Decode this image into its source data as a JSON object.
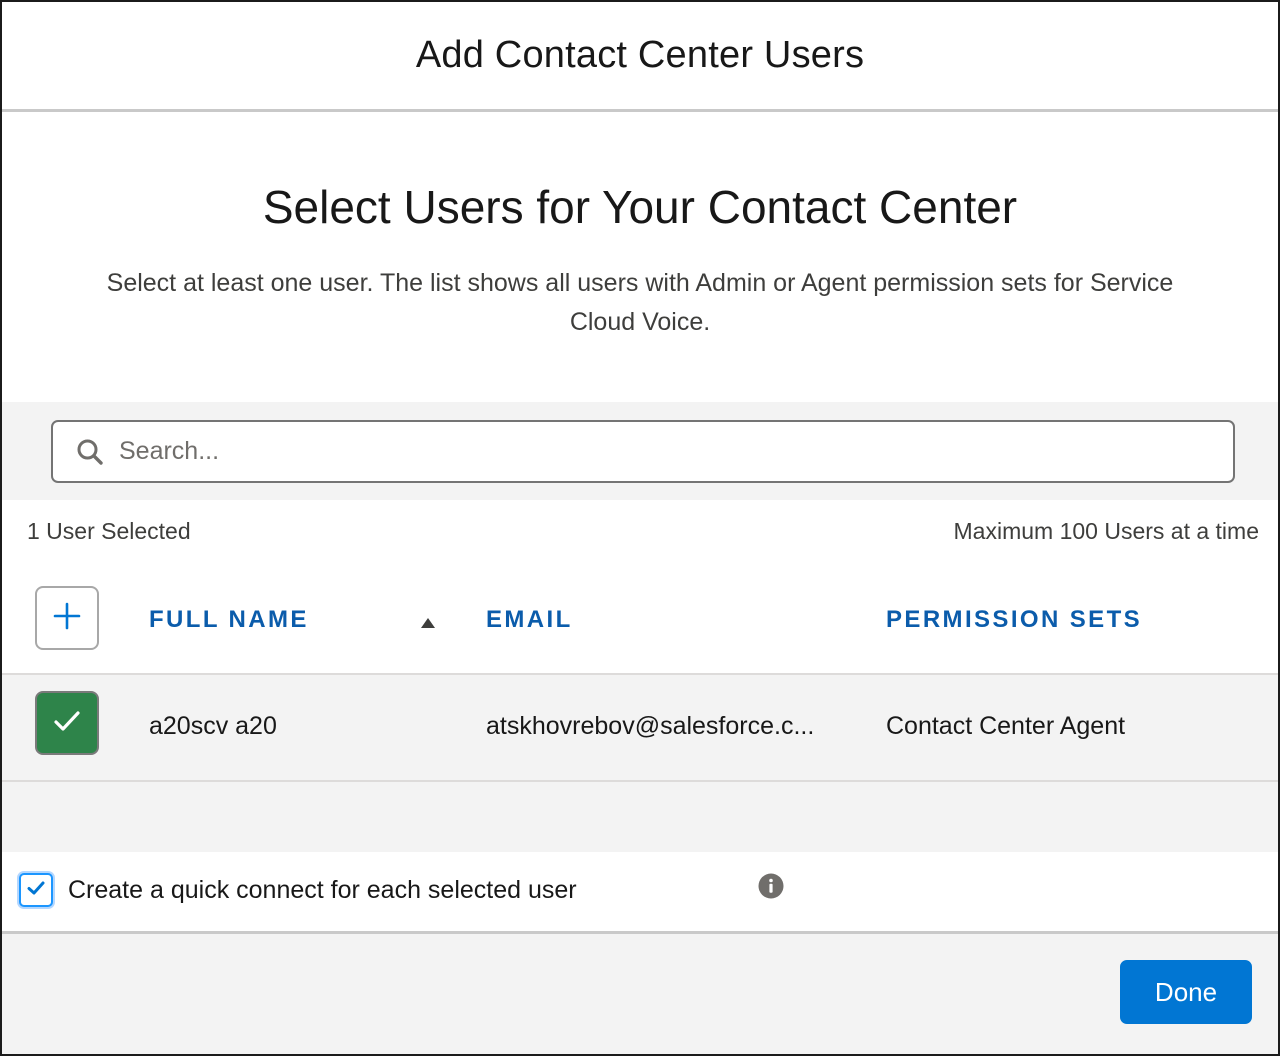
{
  "modal": {
    "title": "Add Contact Center Users"
  },
  "section": {
    "title": "Select Users for Your Contact Center",
    "description": "Select at least one user. The list shows all users with Admin or Agent permission sets for Service Cloud Voice."
  },
  "search": {
    "placeholder": "Search...",
    "value": "",
    "icon": "search-icon"
  },
  "selection": {
    "selected_text": "1 User Selected",
    "max_text": "Maximum 100 Users at a time"
  },
  "table": {
    "add_icon": "plus-icon",
    "columns": [
      "Full Name",
      "Email",
      "Permission Sets"
    ],
    "sort": {
      "column": "Full Name",
      "direction": "ascending"
    },
    "rows": [
      {
        "selected": true,
        "full_name": "a20scv a20",
        "email": "atskhovrebov@salesforce.c...",
        "permission_sets": "Contact Center Agent"
      }
    ]
  },
  "quick_connect": {
    "checked": true,
    "label": "Create a quick connect for each selected user",
    "info_icon": "info-icon"
  },
  "footer": {
    "done_label": "Done"
  },
  "colors": {
    "brand_blue": "#0176d3",
    "header_blue": "#0b5cab",
    "selected_green": "#2e844a",
    "band_gray": "#f3f3f3"
  }
}
